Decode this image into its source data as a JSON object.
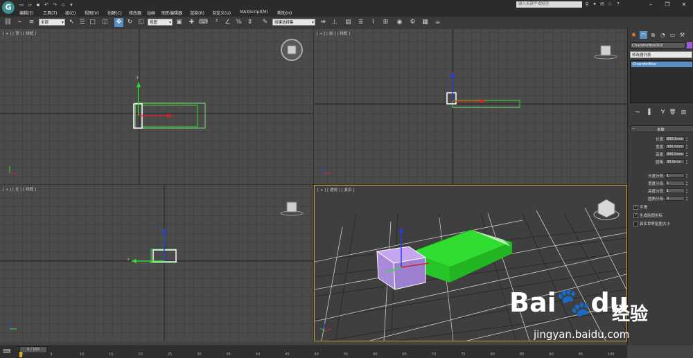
{
  "menu": [
    "编辑(E)",
    "工具(T)",
    "组(G)",
    "视图(V)",
    "创建(C)",
    "修改器",
    "动画",
    "图形编辑器",
    "渲染(R)",
    "自定义(U)",
    "MAXScript(M)",
    "帮助(H)"
  ],
  "search_placeholder": "键入关键字或短语",
  "toolbar": {
    "selection_filter": "全部",
    "ref_coord": "视图",
    "named_selection": "创建选择集"
  },
  "viewports": {
    "top_left": "[ + ] [ 顶 ] [ 线框 ]",
    "top_right": "[ + ] [ 前 ] [ 线框 ]",
    "bottom_left": "[ + ] [ 左 ] [ 线框 ]",
    "bottom_right": "[ + ] [ 透视 ] [ 真实 ]"
  },
  "command_panel": {
    "object_name": "ChamferBox003",
    "modifier_list": "修改器列表",
    "stack_item": "ChamferBox",
    "rollout_title": "参数",
    "params": [
      {
        "label": "长度:",
        "value": "800.0mm"
      },
      {
        "label": "宽度:",
        "value": "300.0mm"
      },
      {
        "label": "高度:",
        "value": "400.0mm"
      },
      {
        "label": "圆角:",
        "value": "30.0mm"
      }
    ],
    "segments": [
      {
        "label": "长度分段:",
        "value": "1"
      },
      {
        "label": "宽度分段:",
        "value": "1"
      },
      {
        "label": "高度分段:",
        "value": "1"
      },
      {
        "label": "圆角分段:",
        "value": "3"
      }
    ],
    "checks": [
      {
        "label": "平滑",
        "checked": true
      },
      {
        "label": "生成贴图坐标",
        "checked": true
      },
      {
        "label": "真实世界贴图大小",
        "checked": false
      }
    ]
  },
  "timeline": {
    "frame": "0 / 100",
    "ticks": [
      "0",
      "5",
      "10",
      "15",
      "20",
      "25",
      "30",
      "35",
      "40",
      "45",
      "50",
      "55",
      "60",
      "65",
      "70",
      "75",
      "80",
      "85",
      "90",
      "95",
      "100"
    ]
  },
  "watermark": {
    "brand": "Bai",
    "brand2": "du",
    "cn": "经验",
    "url": "jingyan.baidu.com"
  },
  "colors": {
    "object_green": "#2fdc2f",
    "selection_purple": "#b69be6",
    "accent_blue": "#5a8fc4"
  }
}
